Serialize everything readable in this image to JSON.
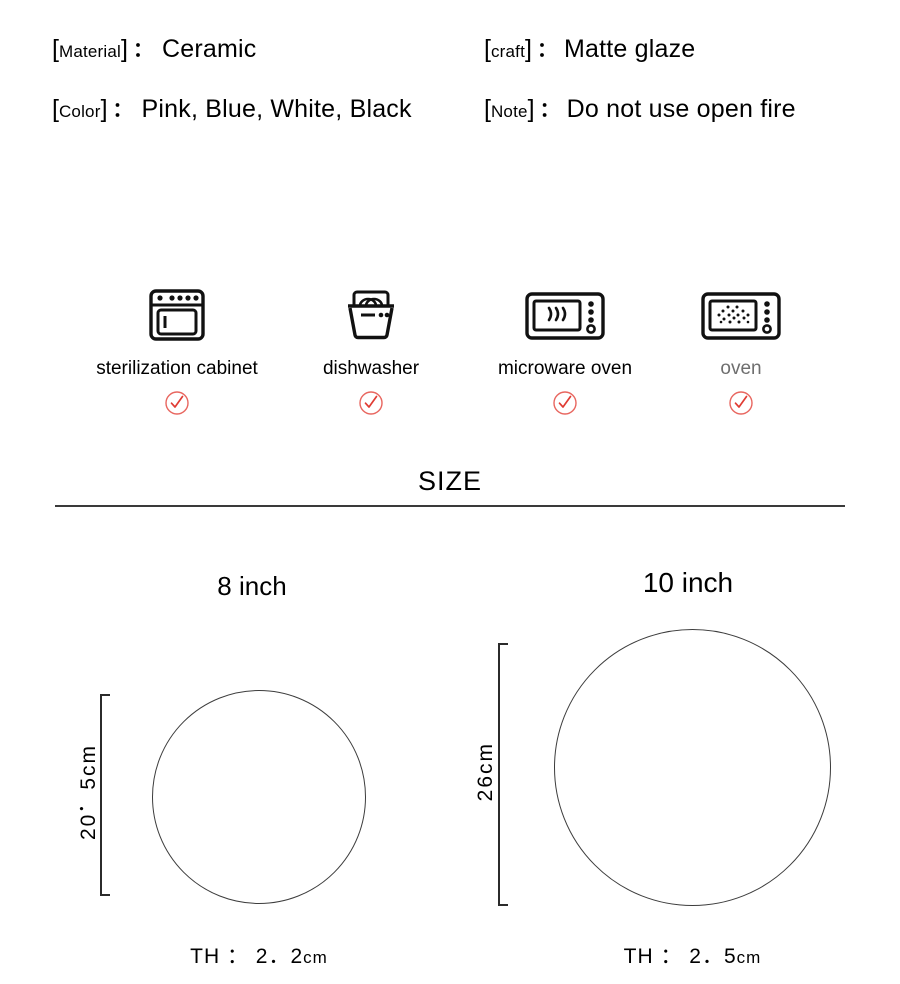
{
  "specs": [
    {
      "key": "Material",
      "bracket_open": "[",
      "bracket_close": "]",
      "colon": "：",
      "value": "Ceramic",
      "column": "left"
    },
    {
      "key": " craft ",
      "bracket_open": "[",
      "bracket_close": "]",
      "colon": "：",
      "value": "Matte glaze",
      "column": "right"
    },
    {
      "key": " Color",
      "bracket_open": "[",
      "bracket_close": "]",
      "colon": "：",
      "value": "Pink, Blue, White, Black",
      "column": "left"
    },
    {
      "key": " Note ",
      "bracket_open": "[",
      "bracket_close": "]",
      "colon": "：",
      "value": "Do not use open fire",
      "column": "right"
    }
  ],
  "appliances": {
    "check_color": "#e8665f",
    "items": [
      {
        "icon": "sterilization-cabinet-icon",
        "label": "sterilization cabinet",
        "label_color": "#000000",
        "supported": true
      },
      {
        "icon": "dishwasher-icon",
        "label": "dishwasher",
        "label_color": "#000000",
        "supported": true
      },
      {
        "icon": "microwave-oven-icon",
        "label": "microware oven",
        "label_color": "#000000",
        "supported": true
      },
      {
        "icon": "oven-icon",
        "label": "oven",
        "label_color": "#6e6e6e",
        "supported": true
      }
    ]
  },
  "size_section": {
    "heading": "SIZE",
    "figures": [
      {
        "title": "8 inch",
        "diameter_label": "20．5cm",
        "thickness_label": "TH  ：  2．2",
        "thickness_unit": "cm"
      },
      {
        "title": "10 inch",
        "diameter_label": "26cm",
        "thickness_label": "TH  ：  2．5",
        "thickness_unit": "cm"
      }
    ]
  }
}
